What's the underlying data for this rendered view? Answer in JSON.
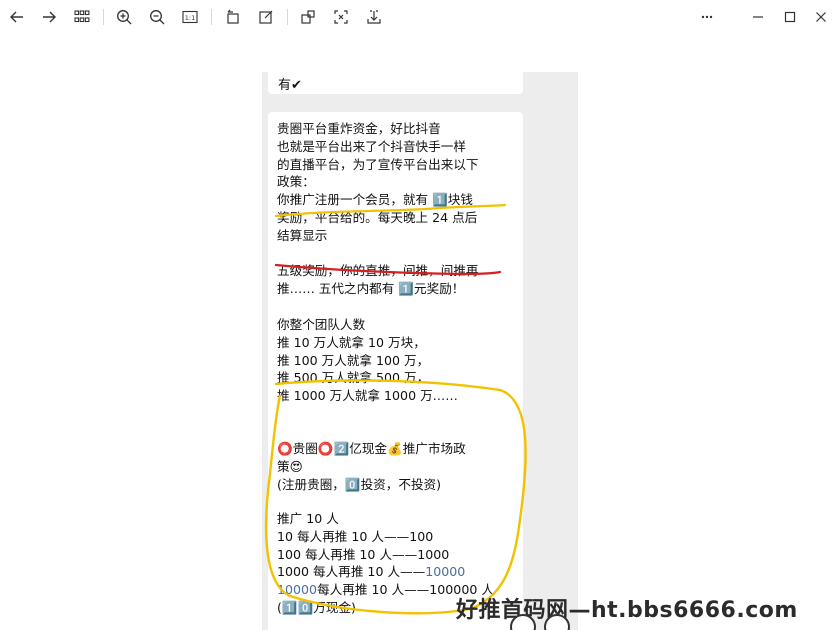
{
  "toolbar": {
    "icons": [
      "back-arrow-icon",
      "forward-arrow-icon",
      "grid-icon",
      "zoom-in-icon",
      "zoom-out-icon",
      "actual-size-icon",
      "rotate-icon",
      "edit-icon",
      "crop-icon",
      "fullscreen-icon",
      "download-icon"
    ],
    "actual_size_label": "1:1"
  },
  "window": {
    "icons": [
      "more-icon",
      "minimize-icon",
      "maximize-icon",
      "close-icon"
    ]
  },
  "chat": {
    "top_bubble_text": "有✔",
    "para1": [
      "贵圈平台重炸资金，好比抖音",
      "也就是平台出来了个抖音快手一样",
      "的直播平台，为了宣传平台出来以下",
      "政策：",
      "你推广注册一个会员，就有 1️⃣块钱",
      "奖励，平台给的。每天晚上 24 点后",
      "结算显示"
    ],
    "para2": [
      "五级奖励，你的直推，间推，间推再",
      "推…… 五代之内都有 1️⃣元奖励！"
    ],
    "para3": [
      "你整个团队人数",
      "推 10 万人就拿 10 万块，",
      "推 100 万人就拿 100 万，",
      "推 500 万人就拿 500 万，",
      "推 1000 万人就拿 1000 万……"
    ],
    "para4": [
      "⭕贵圈⭕2️⃣亿现金💰推广市场政",
      "策😍",
      "(注册贵圈，0️⃣投资，不投资)"
    ],
    "para5": {
      "l1": "推广 10 人",
      "l2": "10 每人再推 10 人——100",
      "l3": "100 每人再推 10 人——1000",
      "l4_a": "1000 每人再推 10 人——",
      "l4_b": "10000",
      "l5_a": "10000",
      "l5_b": "每人再推 10 人——100000 人",
      "l6": "(1️⃣0️⃣万现金)"
    }
  },
  "watermark": "好推首码网—ht.bbs6666.com",
  "colors": {
    "annotation_yellow": "#f2c200",
    "annotation_red": "#d62020",
    "link_blue": "#4a6fa5"
  }
}
